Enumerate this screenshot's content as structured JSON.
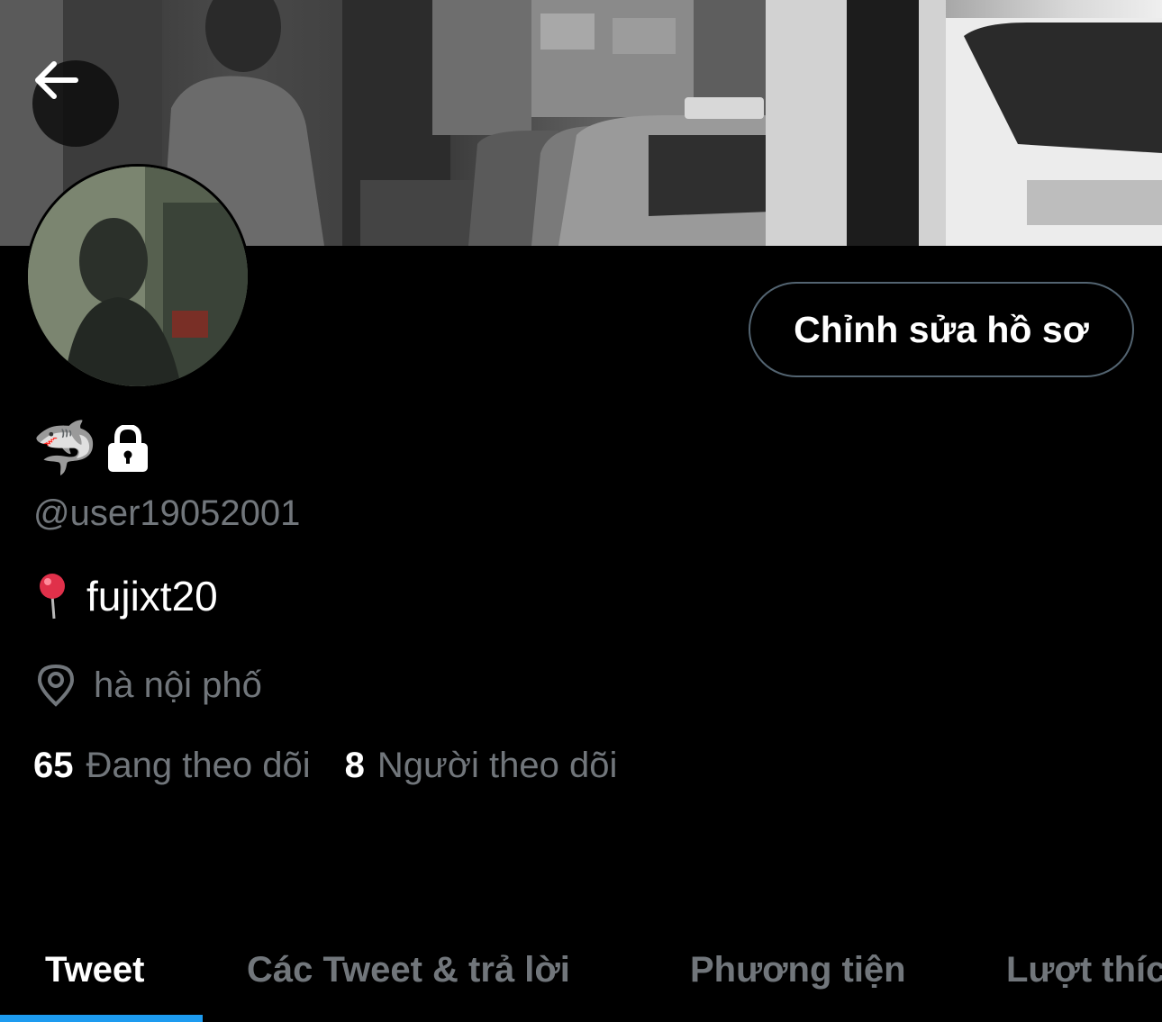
{
  "header": {
    "back_icon": "arrow-left-icon"
  },
  "profile": {
    "display_name_emoji": "🦈",
    "lock_icon": "lock-icon",
    "handle": "@user19052001",
    "bio_icon": "round-pushpin-emoji",
    "bio_emoji": "📍",
    "bio_text": "fujixt20",
    "location_icon": "location-pin-icon",
    "location": "hà nội phố",
    "edit_button_label": "Chỉnh sửa hồ sơ"
  },
  "stats": {
    "following_count": "65",
    "following_label": "Đang theo dõi",
    "followers_count": "8",
    "followers_label": "Người theo dõi"
  },
  "tabs": [
    {
      "label": "Tweet",
      "active": true
    },
    {
      "label": "Các Tweet & trả lời",
      "active": false
    },
    {
      "label": "Phương tiện",
      "active": false
    },
    {
      "label": "Lượt thích",
      "active": false
    }
  ],
  "colors": {
    "background": "#000000",
    "primary_text": "#ffffff",
    "secondary_text": "#71767b",
    "accent": "#1d9bf0",
    "button_border": "#536471"
  }
}
